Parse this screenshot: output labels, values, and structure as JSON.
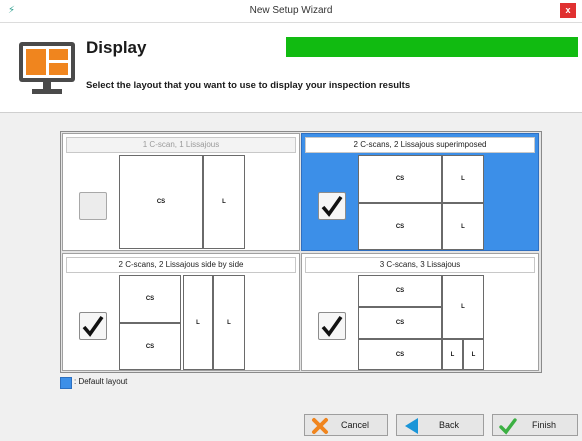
{
  "window": {
    "title": "New Setup Wizard",
    "close_label": "x"
  },
  "header": {
    "title": "Display",
    "subtitle": "Select the layout that you want to use to display your inspection results",
    "progress_fraction": 1.0,
    "progress_color": "#11bb11",
    "icon": "monitor-layout-icon"
  },
  "options": [
    {
      "label": "1 C-scan, 1 Lissajous",
      "checked": false,
      "enabled": false,
      "default": false,
      "panes": [
        "CS",
        "L"
      ]
    },
    {
      "label": "2 C-scans, 2 Lissajous superimposed",
      "checked": true,
      "enabled": true,
      "default": true,
      "panes": [
        "CS",
        "L",
        "CS",
        "L"
      ]
    },
    {
      "label": "2 C-scans, 2 Lissajous side by side",
      "checked": true,
      "enabled": true,
      "default": false,
      "panes": [
        "CS",
        "CS",
        "L",
        "L"
      ]
    },
    {
      "label": "3 C-scans, 3 Lissajous",
      "checked": true,
      "enabled": true,
      "default": false,
      "panes": [
        "CS",
        "CS",
        "CS",
        "L",
        "L",
        "L"
      ]
    }
  ],
  "legend": {
    "label": ": Default layout",
    "color": "#3c8fe8"
  },
  "buttons": {
    "cancel": "Cancel",
    "back": "Back",
    "finish": "Finish"
  },
  "colors": {
    "selected": "#3c8fe8",
    "accent_orange": "#f0851e"
  }
}
